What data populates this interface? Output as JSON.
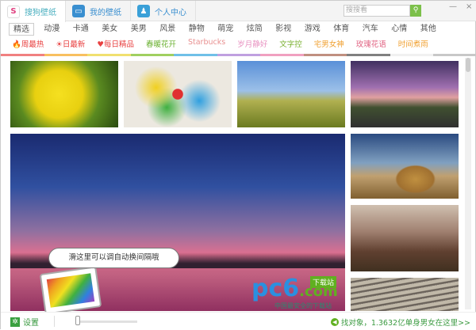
{
  "tabs": [
    {
      "label": "搜狗壁纸",
      "icon": "sogou-logo-icon"
    },
    {
      "label": "我的壁纸",
      "icon": "monitor-icon"
    },
    {
      "label": "个人中心",
      "icon": "user-icon"
    }
  ],
  "search": {
    "placeholder": "搜搜看"
  },
  "categories": [
    "精选",
    "动漫",
    "卡通",
    "美女",
    "美男",
    "风景",
    "静物",
    "萌宠",
    "炫简",
    "影视",
    "游戏",
    "体育",
    "汽车",
    "心情",
    "其他"
  ],
  "tags": [
    {
      "label": "周最热",
      "color": "#e84040"
    },
    {
      "label": "日最新",
      "color": "#e84040"
    },
    {
      "label": "每日精品",
      "color": "#e84040"
    },
    {
      "label": "春暖花开",
      "color": "#6ab030"
    },
    {
      "label": "Starbucks",
      "color": "#e89090"
    },
    {
      "label": "岁月静好",
      "color": "#e890c0"
    },
    {
      "label": "文字控",
      "color": "#7ab030"
    },
    {
      "label": "宅男女神",
      "color": "#f0a030"
    },
    {
      "label": "玫瑰花语",
      "color": "#e06080"
    },
    {
      "label": "时间煮雨",
      "color": "#f0a030"
    }
  ],
  "bubble": "滑这里可以调自动换间隔哦",
  "watermark": {
    "brand": "pc6",
    "suffix": ".com",
    "badge": "下载站",
    "slogan": "中国最安全的下载站"
  },
  "footer": {
    "settings": "设置",
    "promo": "找对象，1.3632亿单身男女在这里>>"
  }
}
